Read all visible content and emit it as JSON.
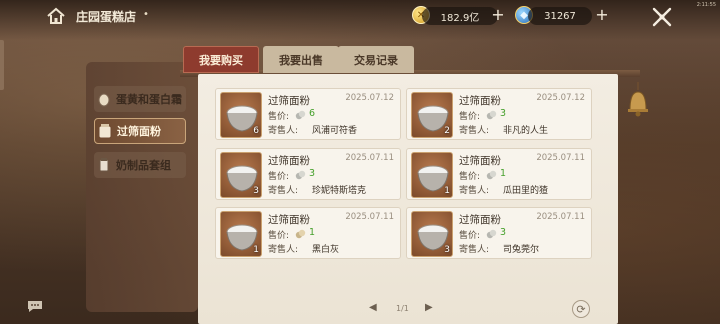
{
  "header": {
    "title": "庄园蛋糕店",
    "gold_amount": "182.9亿",
    "gem_amount": "31267",
    "corner_text": "2:11:55"
  },
  "colors": {
    "active_tab": "#8e3b2e",
    "inactive_tab": "#c9b99f",
    "price_green": "#46a02c",
    "parchment": "#f3ede2"
  },
  "categories": [
    {
      "label": "蛋黄和蛋白霜",
      "active": false,
      "icon": "egg-icon"
    },
    {
      "label": "过筛面粉",
      "active": true,
      "icon": "flour-sack-icon"
    },
    {
      "label": "奶制品套组",
      "active": false,
      "icon": "dairy-icon"
    }
  ],
  "tabs": [
    {
      "label": "我要购买",
      "active": true
    },
    {
      "label": "我要出售",
      "active": false
    },
    {
      "label": "交易记录",
      "active": false
    }
  ],
  "listing_labels": {
    "price": "售价:",
    "seller": "寄售人:"
  },
  "listings": [
    {
      "name": "过筛面粉",
      "date": "2025.07.12",
      "price": "6",
      "seller": "风浦可符香",
      "quantity": "6"
    },
    {
      "name": "过筛面粉",
      "date": "2025.07.12",
      "price": "3",
      "seller": "非凡的人生",
      "quantity": "2"
    },
    {
      "name": "过筛面粉",
      "date": "2025.07.11",
      "price": "3",
      "seller": "珍妮特斯塔克",
      "quantity": "3"
    },
    {
      "name": "过筛面粉",
      "date": "2025.07.11",
      "price": "1",
      "seller": "瓜田里的猹",
      "quantity": "1"
    },
    {
      "name": "过筛面粉",
      "date": "2025.07.11",
      "price": "1",
      "seller": "黑白灰",
      "quantity": "1"
    },
    {
      "name": "过筛面粉",
      "date": "2025.07.11",
      "price": "3",
      "seller": "司兔莞尔",
      "quantity": "3"
    }
  ],
  "pagination": {
    "text": "1/1"
  }
}
